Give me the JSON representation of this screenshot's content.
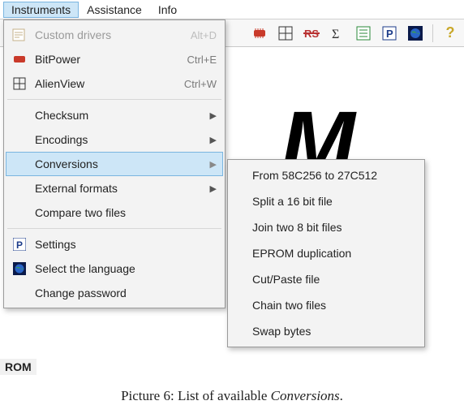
{
  "menubar": {
    "items": [
      "Instruments",
      "Assistance",
      "Info"
    ]
  },
  "toolbar_right": {
    "help_mark": "?"
  },
  "dropdown": {
    "group1": [
      {
        "label": "Custom drivers",
        "shortcut": "Alt+D",
        "icon": "script",
        "disabled": true
      },
      {
        "label": "BitPower",
        "shortcut": "Ctrl+E",
        "icon": "chip",
        "disabled": false
      },
      {
        "label": "AlienView",
        "shortcut": "Ctrl+W",
        "icon": "grid4",
        "disabled": false
      }
    ],
    "group2": [
      {
        "label": "Checksum",
        "arrow": true
      },
      {
        "label": "Encodings",
        "arrow": true
      },
      {
        "label": "Conversions",
        "arrow": true,
        "highlight": true
      },
      {
        "label": "External formats",
        "arrow": true
      },
      {
        "label": "Compare two files",
        "arrow": false
      }
    ],
    "group3": [
      {
        "label": "Settings",
        "icon": "P-box"
      },
      {
        "label": "Select the language",
        "icon": "globe"
      },
      {
        "label": "Change password",
        "icon": ""
      }
    ]
  },
  "submenu": {
    "items": [
      "From 58C256 to 27C512",
      "Split a 16 bit file",
      "Join two 8 bit files",
      "EPROM duplication",
      "Cut/Paste file",
      "Chain two files",
      "Swap bytes"
    ]
  },
  "bottom_label": "ROM",
  "caption_prefix": "Picture 6: List of available ",
  "caption_emph": "Conversions",
  "caption_suffix": "."
}
